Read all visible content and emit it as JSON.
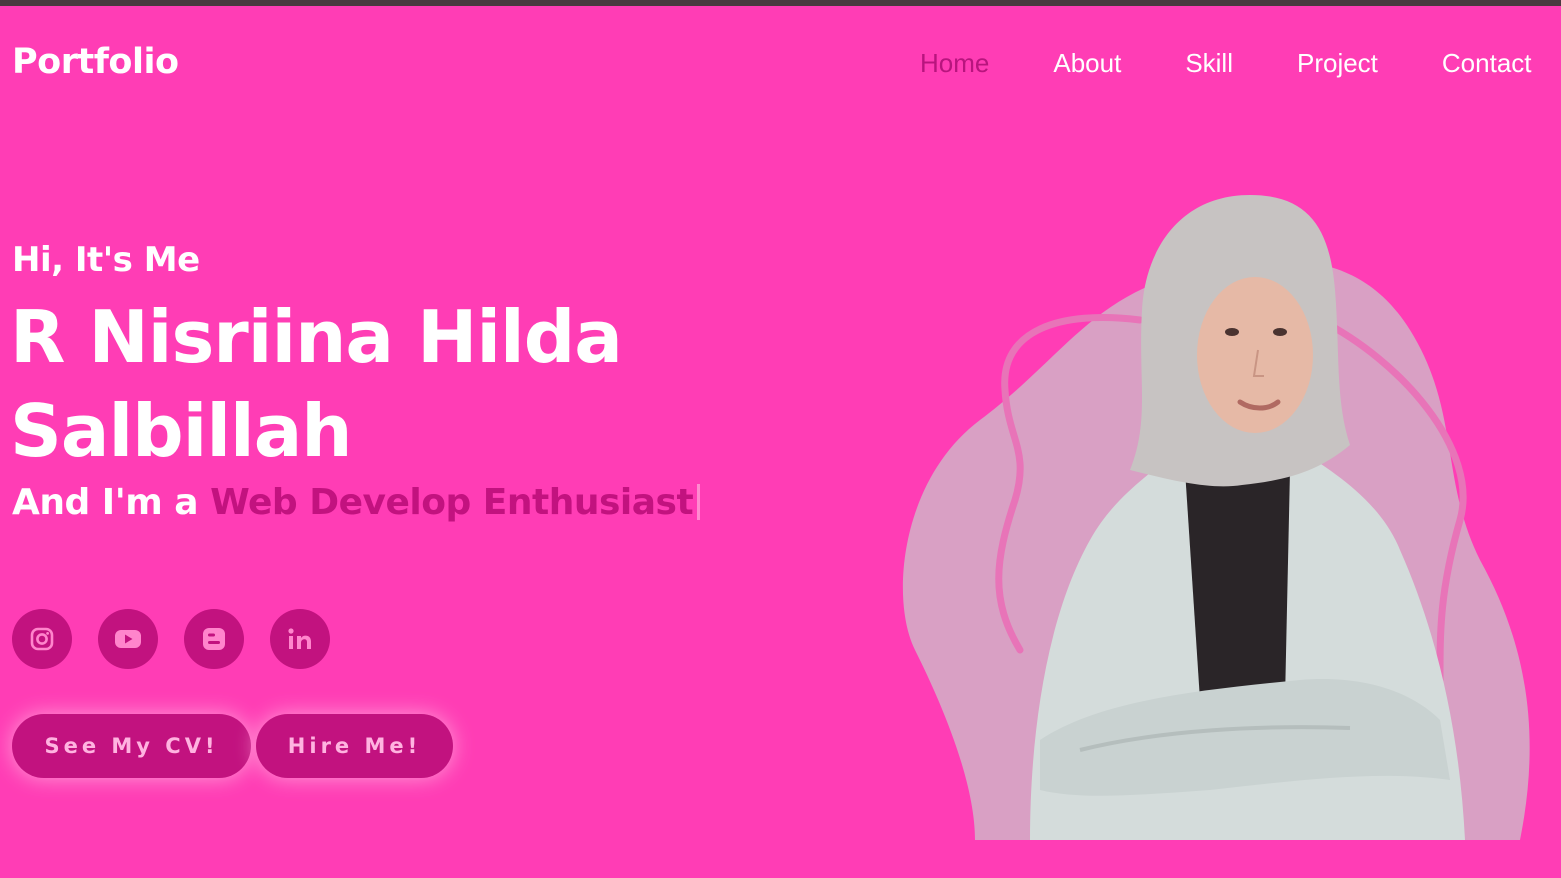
{
  "header": {
    "logo": "Portfolio",
    "nav": [
      "Home",
      "About",
      "Skill",
      "Project",
      "Contact"
    ],
    "active_nav": "Home"
  },
  "hero": {
    "greeting": "Hi, It's Me",
    "name_line1": "R Nisriina Hilda",
    "name_line2": "Salbillah",
    "role_prefix": "And I'm a ",
    "role_typed": "Web Develop Enthusiast"
  },
  "socials": [
    "instagram-icon",
    "youtube-icon",
    "blogger-icon",
    "linkedin-icon"
  ],
  "buttons": {
    "cv": "See My CV!",
    "hire": "Hire Me!"
  },
  "colors": {
    "background": "#ff3db5",
    "accent": "#c2127f",
    "text": "#ffffff",
    "blob": "#d9a0c4"
  }
}
